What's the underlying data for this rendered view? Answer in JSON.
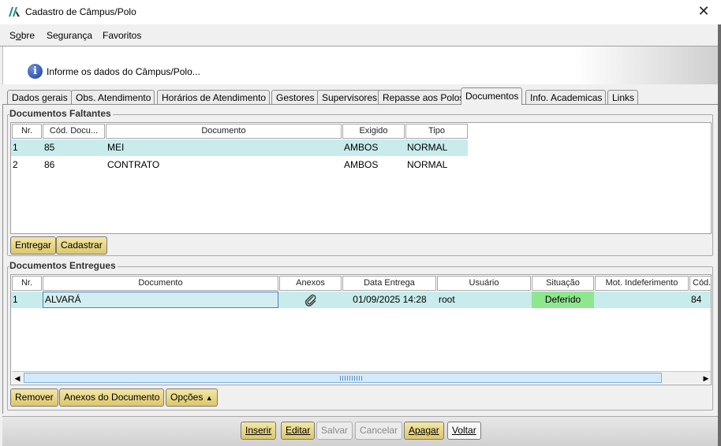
{
  "window": {
    "title": "Cadastro de Câmpus/Polo",
    "close_glyph": "✕"
  },
  "menu": [
    {
      "label_pre": "S",
      "label_u": "o",
      "label_post": "bre"
    },
    {
      "label": "Segurança"
    },
    {
      "label": "Favoritos"
    }
  ],
  "info": {
    "icon": "info-icon",
    "text": "Informe os dados do Câmpus/Polo..."
  },
  "tabs": [
    "Dados gerais",
    "Obs. Atendimento",
    "Horários de Atendimento",
    "Gestores",
    "Supervisores",
    "Repasse aos Polos",
    "Documentos",
    "Info. Academicas",
    "Links"
  ],
  "active_tab": "Documentos",
  "faltantes": {
    "title": "Documentos Faltantes",
    "columns": [
      "Nr.",
      "Cód. Docu...",
      "Documento",
      "Exigido",
      "Tipo"
    ],
    "rows": [
      {
        "nr": "1",
        "cod": "85",
        "documento": "MEI",
        "exigido": "AMBOS",
        "tipo": "NORMAL"
      },
      {
        "nr": "2",
        "cod": "86",
        "documento": "CONTRATO",
        "exigido": "AMBOS",
        "tipo": "NORMAL"
      }
    ],
    "buttons": {
      "entregar": "Entregar",
      "cadastrar": "Cadastrar"
    }
  },
  "entregues": {
    "title": "Documentos Entregues",
    "columns": [
      "Nr.",
      "Documento",
      "Anexos",
      "Data Entrega",
      "Usuário",
      "Situação",
      "Mot. Indeferimento",
      "Cód."
    ],
    "rows": [
      {
        "nr": "1",
        "documento": "ALVARÁ",
        "anexos_icon": "paperclip-icon",
        "data": "01/09/2025 14:28",
        "usuario": "root",
        "situacao": "Deferido",
        "mot": "",
        "cod": "84"
      }
    ],
    "buttons": {
      "remover": "Remover",
      "anexos": "Anexos do Documento",
      "opcoes": "Opções",
      "opcoes_icon": "triangle-up-icon"
    }
  },
  "actions": {
    "inserir": "Inserir",
    "editar": "Editar",
    "salvar": "Salvar",
    "cancelar": "Cancelar",
    "apagar": "Apagar",
    "voltar": "Voltar"
  },
  "colors": {
    "row_highlight": "#c8ebeb",
    "deferido_bg": "#8ee68e",
    "button_gold": "#e6d27e",
    "info_blue": "#1a3c9c"
  }
}
